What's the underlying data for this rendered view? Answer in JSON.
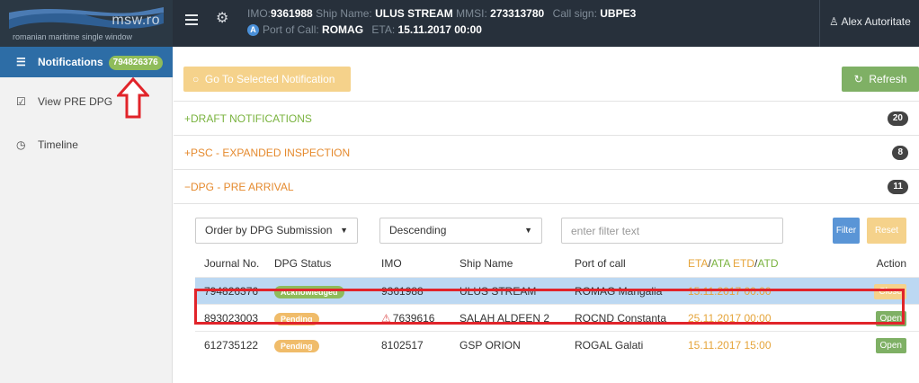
{
  "header": {
    "logo_brand": "msw.ro",
    "logo_subtitle": "romanian maritime single window",
    "imo_label": "IMO:",
    "imo": "9361988",
    "ship_name_label": "Ship Name:",
    "ship_name": "ULUS STREAM",
    "mmsi_label": "MMSI:",
    "mmsi": "273313780",
    "call_sign_label": "Call sign:",
    "call_sign": "UBPE3",
    "badge": "A",
    "port_label": "Port of Call:",
    "port": "ROMAG",
    "eta_label": "ETA:",
    "eta": "15.11.2017 00:00",
    "user": "Alex Autoritate"
  },
  "sidebar": {
    "items": [
      {
        "label": "Notifications",
        "count": "794826376",
        "icon": "list-icon"
      },
      {
        "label": "View PRE DPG",
        "icon": "checkbox-icon"
      },
      {
        "label": "Timeline",
        "icon": "clock-icon"
      }
    ]
  },
  "toolbar": {
    "goto_label": "Go To Selected Notification",
    "refresh_label": "Refresh"
  },
  "sections": [
    {
      "prefix": "+",
      "title": "DRAFT NOTIFICATIONS",
      "count": "20"
    },
    {
      "prefix": "+",
      "title": "PSC - EXPANDED INSPECTION",
      "count": "8"
    },
    {
      "prefix": "−",
      "title": "DPG - PRE ARRIVAL",
      "count": "11"
    }
  ],
  "filters": {
    "order_by": "Order by DPG Submission I",
    "direction": "Descending",
    "filter_placeholder": "enter filter text",
    "filter_label": "Filter",
    "reset_label": "Reset"
  },
  "table": {
    "columns": {
      "journal": "Journal No.",
      "status": "DPG Status",
      "imo": "IMO",
      "ship": "Ship Name",
      "port": "Port of call",
      "eta": "ETA",
      "ata": "ATA",
      "etd": "ETD",
      "atd": "ATD",
      "action": "Action"
    },
    "rows": [
      {
        "journal": "794826376",
        "status": "Acknowledged",
        "imo": "9361988",
        "ship": "ULUS STREAM",
        "port": "ROMAG Mangalia",
        "eta": "15.11.2017 00:00",
        "action": "Close"
      },
      {
        "journal": "893023003",
        "status": "Pending",
        "imo": "7639616",
        "ship": "SALAH ALDEEN 2",
        "port": "ROCND Constanta",
        "eta": "25.11.2017 00:00",
        "action": "Open"
      },
      {
        "journal": "612735122",
        "status": "Pending",
        "imo": "8102517",
        "ship": "GSP ORION",
        "port": "ROGAL Galati",
        "eta": "15.11.2017 15:00",
        "action": "Open"
      }
    ]
  },
  "colors": {
    "topbar": "#27303b",
    "accent_blue": "#2d6da6",
    "green": "#7fb065",
    "orange": "#e58a2e",
    "highlight_red": "#e1242a",
    "selected_row": "#bcd8f2"
  }
}
